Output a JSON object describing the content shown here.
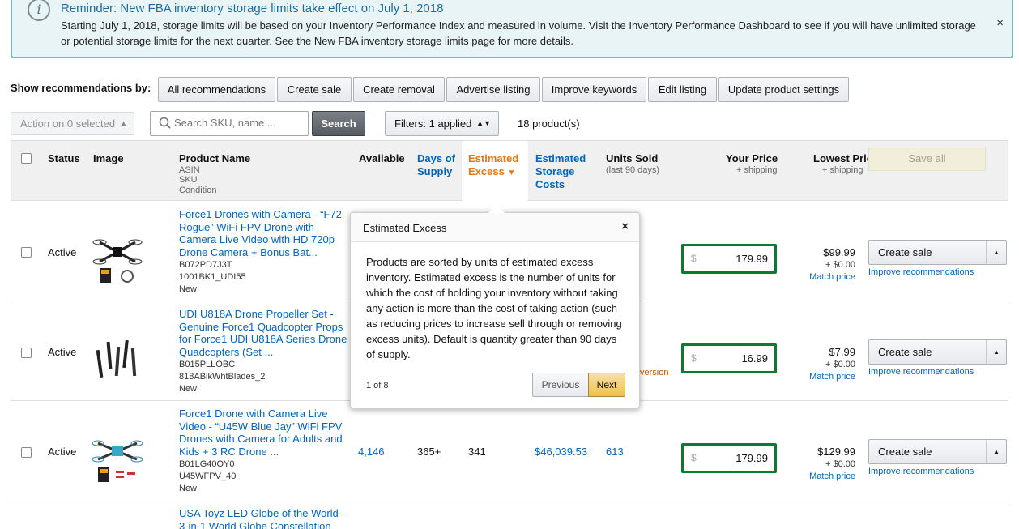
{
  "banner": {
    "icon": "info-icon",
    "title": "Reminder: New FBA inventory storage limits take effect on July 1, 2018",
    "body": "Starting July 1, 2018, storage limits will be based on your Inventory Performance Index and measured in volume. Visit the Inventory Performance Dashboard to see if you will have unlimited storage or potential storage limits for the next quarter. See the New FBA inventory storage limits page for more details.",
    "close": "×"
  },
  "recommendations": {
    "label": "Show recommendations by:",
    "buttons": [
      "All recommendations",
      "Create sale",
      "Create removal",
      "Advertise listing",
      "Improve keywords",
      "Edit listing",
      "Update product settings"
    ]
  },
  "toolbar": {
    "action_select": "Action on 0 selected",
    "search_placeholder": "Search SKU, name ...",
    "search_button": "Search",
    "filters": "Filters: 1 applied",
    "product_count": "18 product(s)"
  },
  "table": {
    "headers": {
      "status": "Status",
      "image": "Image",
      "product_name": "Product Name",
      "product_sub": [
        "ASIN",
        "SKU",
        "Condition"
      ],
      "available": "Available",
      "days_of_supply": [
        "Days of",
        "Supply"
      ],
      "estimated_excess": [
        "Estimated",
        "Excess"
      ],
      "estimated_storage": [
        "Estimated",
        "Storage",
        "Costs"
      ],
      "units_sold": "Units Sold",
      "units_sold_sub": "(last 90 days)",
      "your_price": "Your Price",
      "your_price_sub": "+ shipping",
      "lowest_price": "Lowest Price",
      "lowest_price_sub": "+ shipping",
      "save_all": "Save all"
    },
    "rows": [
      {
        "status": "Active",
        "name": "Force1 Drones with Camera - “F72 Rogue” WiFi FPV Drone with Camera Live Video with HD 720p Drone Camera + Bonus Bat...",
        "asin": "B072PD7J3T",
        "sku": "1001BK1_UDI55",
        "condition": "New",
        "available": "",
        "days": "",
        "excess": "",
        "storage": "",
        "units": "",
        "currency": "$",
        "your_price": "179.99",
        "lowest_price": "$99.99",
        "shipping": "+ $0.00",
        "match": "Match price",
        "action": "Create sale",
        "improve": "Improve recommendations"
      },
      {
        "status": "Active",
        "name": "UDI U818A Drone Propeller Set - Genuine Force1 Quadcopter Props for Force1 UDI U818A Series Drone Quadcopters (Set ...",
        "asin": "B015PLLOBC",
        "sku": "818ABlkWhtBlades_2",
        "condition": "New",
        "available": "",
        "days": "",
        "excess": "",
        "storage": "",
        "units": "",
        "extra": "version",
        "currency": "$",
        "your_price": "16.99",
        "lowest_price": "$7.99",
        "shipping": "+ $0.00",
        "match": "Match price",
        "action": "Create sale",
        "improve": "Improve recommendations"
      },
      {
        "status": "Active",
        "name": "Force1 Drone with Camera Live Video - “U45W Blue Jay” WiFi FPV Drones with Camera for Adults and Kids + 3 RC Drone ...",
        "asin": "B01LG40OY0",
        "sku": "U45WFPV_40",
        "condition": "New",
        "available": "4,146",
        "days": "365+",
        "excess": "341",
        "storage": "$46,039.53",
        "units": "613",
        "currency": "$",
        "your_price": "179.99",
        "lowest_price": "$129.99",
        "shipping": "+ $0.00",
        "match": "Match price",
        "action": "Create sale",
        "improve": "Improve recommendations"
      },
      {
        "name": "USA Toyz LED Globe of the World – 3-in-1 World Globe Constellation"
      }
    ]
  },
  "popover": {
    "title": "Estimated Excess",
    "close": "×",
    "body": "Products are sorted by units of estimated excess inventory. Estimated excess is the number of units for which the cost of holding your inventory without taking any action is more than the cost of taking action (such as reducing prices to increase sell through or removing excess units). Default is quantity greater than 90 days of supply.",
    "page": "1 of 8",
    "previous": "Previous",
    "next": "Next"
  }
}
